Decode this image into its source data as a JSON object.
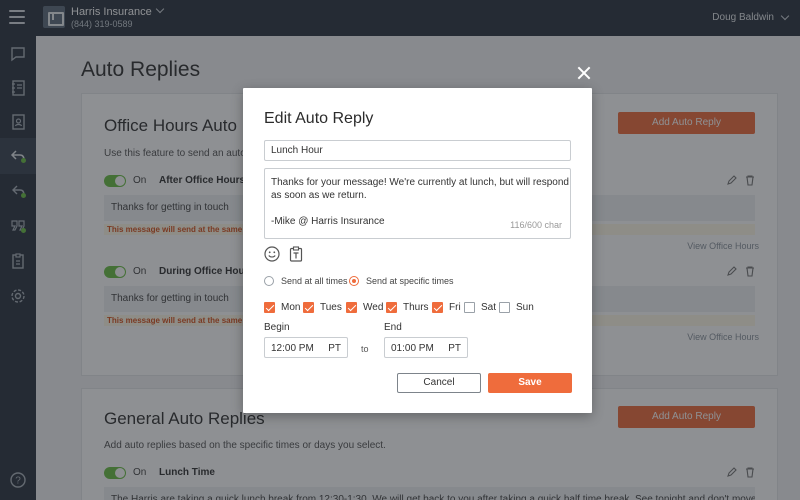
{
  "header": {
    "company_name": "Harris Insurance",
    "phone": "(844) 319-0589",
    "user_name": "Doug Baldwin"
  },
  "sidebar": {
    "items": [
      {
        "icon": "chat-icon"
      },
      {
        "icon": "contacts-book-icon"
      },
      {
        "icon": "contact-card-icon"
      },
      {
        "icon": "auto-reply-icon",
        "active": true
      },
      {
        "icon": "reply-all-icon"
      },
      {
        "icon": "quote-icon"
      },
      {
        "icon": "clipboard-icon"
      },
      {
        "icon": "settings-icon"
      },
      {
        "icon": "help-icon"
      }
    ],
    "help_label": "?"
  },
  "page": {
    "title": "Auto Replies"
  },
  "office_hours": {
    "title": "Office Hours Auto",
    "description": "Use this feature to send an auto",
    "add_button": "Add Auto Reply",
    "rules": [
      {
        "on_label": "On",
        "name": "After Office Hours",
        "message": "Thanks for getting in touch",
        "warning": "This message will send at the same",
        "view_link": "View Office Hours"
      },
      {
        "on_label": "On",
        "name": "During Office Hou",
        "message": "Thanks for getting in touch",
        "warning": "This message will send at the same",
        "view_link": "View Office Hours"
      }
    ]
  },
  "general": {
    "title": "General Auto Replies",
    "description": "Add auto replies based on the specific times or days you select.",
    "add_button": "Add Auto Reply",
    "rule": {
      "on_label": "On",
      "name": "Lunch Time",
      "message": "The Harris are taking a quick lunch break from 12:30-1:30. We will get back to you after taking a quick half time break. See tonight and don't move a"
    }
  },
  "modal": {
    "title": "Edit Auto Reply",
    "name_value": "Lunch Hour",
    "message_lines": [
      "Thanks for your message! We're currently at lunch, but will respond",
      "as soon as we return."
    ],
    "signature": "-Mike @ Harris Insurance",
    "char_count": "116/600 char",
    "send_options": {
      "all_times": "Send at all times",
      "specific_times": "Send at specific times",
      "selected": "specific_times"
    },
    "days": [
      {
        "label": "Mon",
        "checked": true
      },
      {
        "label": "Tues",
        "checked": true
      },
      {
        "label": "Wed",
        "checked": true
      },
      {
        "label": "Thurs",
        "checked": true
      },
      {
        "label": "Fri",
        "checked": true
      },
      {
        "label": "Sat",
        "checked": false
      },
      {
        "label": "Sun",
        "checked": false
      }
    ],
    "begin_label": "Begin",
    "end_label": "End",
    "begin_time": "12:00 PM",
    "begin_tz": "PT",
    "to_label": "to",
    "end_time": "01:00 PM",
    "end_tz": "PT",
    "cancel_label": "Cancel",
    "save_label": "Save"
  },
  "colors": {
    "accent": "#ef6c3c",
    "toggle_on": "#6abf44",
    "topbar": "#2c3440",
    "warning_text": "#d7521e"
  }
}
